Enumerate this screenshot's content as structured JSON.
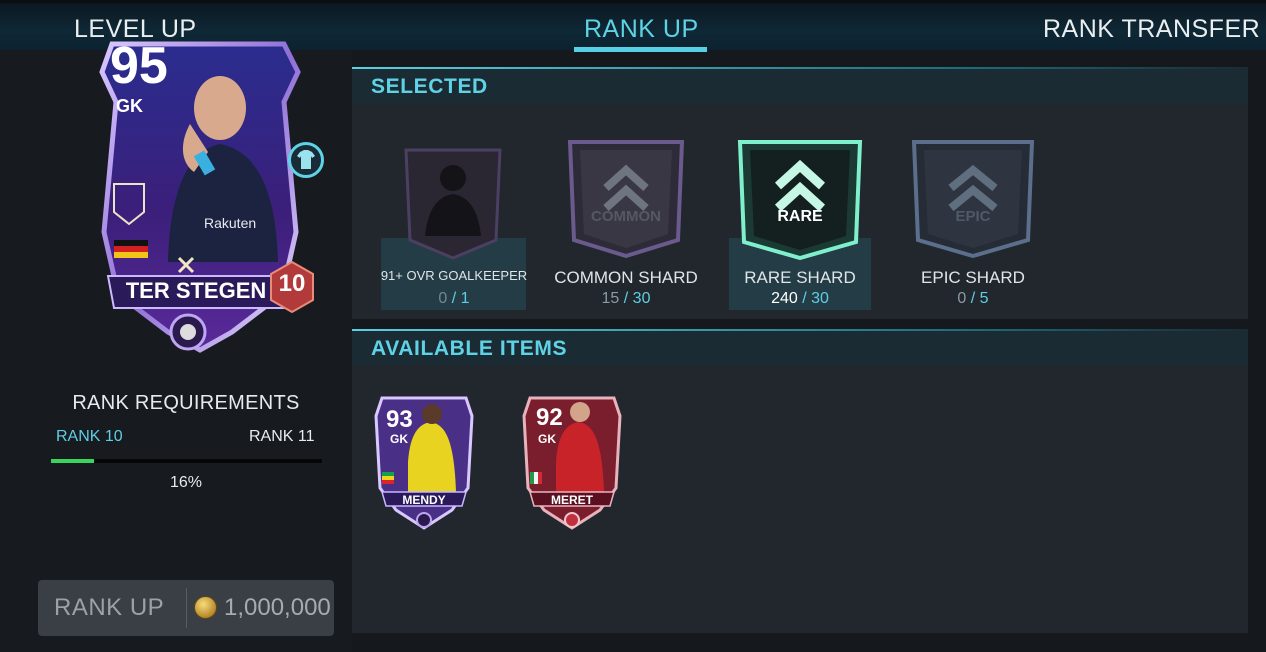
{
  "tabs": {
    "level_up": "LEVEL UP",
    "rank_up": "RANK UP",
    "rank_transfer": "RANK TRANSFER"
  },
  "player_card": {
    "rating": "95",
    "position": "GK",
    "name": "TER STEGEN",
    "rank": "10",
    "sponsor": "Rakuten"
  },
  "rank_requirements": {
    "title": "RANK REQUIREMENTS",
    "from": "RANK 10",
    "to": "RANK 11",
    "progress_fraction": 0.16,
    "progress_text": "16%"
  },
  "rank_up_button": {
    "label": "RANK UP",
    "cost": "1,000,000",
    "icon": "coin-icon"
  },
  "selected": {
    "title": "SELECTED",
    "items": [
      {
        "label": "91+ OVR GOALKEEPER",
        "have": "0",
        "need": "1",
        "shard_text": ""
      },
      {
        "label": "COMMON SHARD",
        "have": "15",
        "need": "30",
        "shard_text": "COMMON"
      },
      {
        "label": "RARE SHARD",
        "have": "240",
        "need": "30",
        "shard_text": "RARE"
      },
      {
        "label": "EPIC SHARD",
        "have": "0",
        "need": "5",
        "shard_text": "EPIC"
      }
    ]
  },
  "available": {
    "title": "AVAILABLE ITEMS",
    "cards": [
      {
        "rating": "93",
        "position": "GK",
        "name": "MENDY"
      },
      {
        "rating": "92",
        "position": "GK",
        "name": "MERET"
      }
    ]
  },
  "colors": {
    "accent": "#5ed3e6",
    "progress": "#39d45c",
    "card_purple": "#4b2a8a",
    "rare_green": "#3fd6a6",
    "rank_badge": "#b23a3a"
  }
}
